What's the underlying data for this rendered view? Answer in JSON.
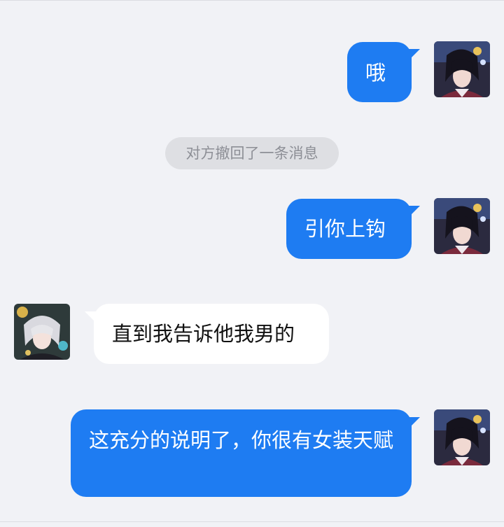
{
  "messages": [
    {
      "side": "me",
      "text": "哦",
      "avatar": "user-avatar-dark-hair"
    },
    {
      "side": "system",
      "text": "对方撤回了一条消息"
    },
    {
      "side": "me",
      "text": "引你上钩",
      "avatar": "user-avatar-dark-hair"
    },
    {
      "side": "other",
      "text": "直到我告诉他我男的",
      "avatar": "contact-avatar-silver-hair"
    },
    {
      "side": "me",
      "text": "这充分的说明了，你很有女装天赋",
      "avatar": "user-avatar-dark-hair"
    }
  ],
  "colors": {
    "background": "#f1f2f6",
    "me_bubble": "#1e7cf2",
    "other_bubble": "#ffffff",
    "system_pill": "#dedfe3",
    "system_text": "#8d8f96"
  }
}
